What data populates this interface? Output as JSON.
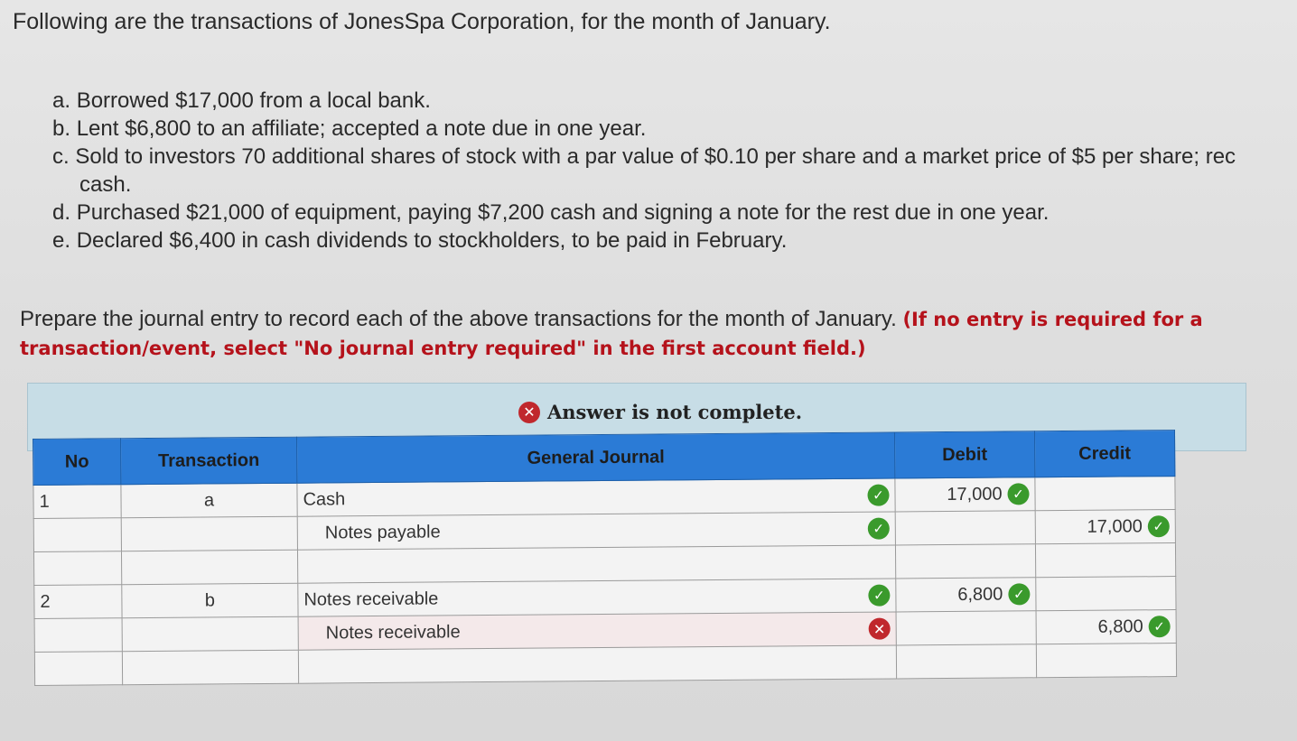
{
  "intro": "Following are the transactions of JonesSpa Corporation, for the month of January.",
  "transactions": [
    {
      "letter": "a.",
      "text": "Borrowed $17,000 from a local bank."
    },
    {
      "letter": "b.",
      "text": "Lent $6,800 to an affiliate; accepted a note due in one year."
    },
    {
      "letter": "c.",
      "text": "Sold to investors 70 additional shares of stock with a par value of $0.10 per share and a market price of $5 per share; rec"
    },
    {
      "letter": "",
      "text": "cash."
    },
    {
      "letter": "d.",
      "text": "Purchased $21,000 of equipment, paying $7,200 cash and signing a note for the rest due in one year."
    },
    {
      "letter": "e.",
      "text": "Declared $6,400 in cash dividends to stockholders, to be paid in February."
    }
  ],
  "instruction": {
    "text": "Prepare the journal entry to record each of the above transactions for the month of January. ",
    "highlight": "(If no entry is required for a transaction/event, select \"No journal entry required\" in the first account field.)"
  },
  "answer_status": "Answer is not complete.",
  "table": {
    "headers": {
      "no": "No",
      "transaction": "Transaction",
      "journal": "General Journal",
      "debit": "Debit",
      "credit": "Credit"
    },
    "rows": [
      {
        "no": "1",
        "transaction": "a",
        "account": "Cash",
        "indent": false,
        "debit": "17,000",
        "credit": "",
        "account_status": "correct",
        "debit_status": "correct",
        "credit_status": ""
      },
      {
        "no": "",
        "transaction": "",
        "account": "Notes payable",
        "indent": true,
        "debit": "",
        "credit": "17,000",
        "account_status": "correct",
        "debit_status": "",
        "credit_status": "correct"
      },
      {
        "no": "",
        "transaction": "",
        "account": "",
        "indent": false,
        "debit": "",
        "credit": "",
        "account_status": "",
        "debit_status": "",
        "credit_status": ""
      },
      {
        "no": "2",
        "transaction": "b",
        "account": "Notes receivable",
        "indent": false,
        "debit": "6,800",
        "credit": "",
        "account_status": "correct",
        "debit_status": "correct",
        "credit_status": ""
      },
      {
        "no": "",
        "transaction": "",
        "account": "Notes receivable",
        "indent": true,
        "debit": "",
        "credit": "6,800",
        "account_status": "incorrect",
        "debit_status": "",
        "credit_status": "correct"
      },
      {
        "no": "",
        "transaction": "",
        "account": "",
        "indent": false,
        "debit": "",
        "credit": "",
        "account_status": "",
        "debit_status": "",
        "credit_status": ""
      }
    ]
  },
  "colors": {
    "header_blue": "#2b7bd6",
    "panel_blue": "#c7dde6",
    "correct_green": "#3a9a2c",
    "incorrect_red": "#c0282d",
    "emphasis_red": "#b5121b"
  },
  "icons": {
    "correct": "check-circle-icon",
    "incorrect": "x-circle-icon"
  }
}
